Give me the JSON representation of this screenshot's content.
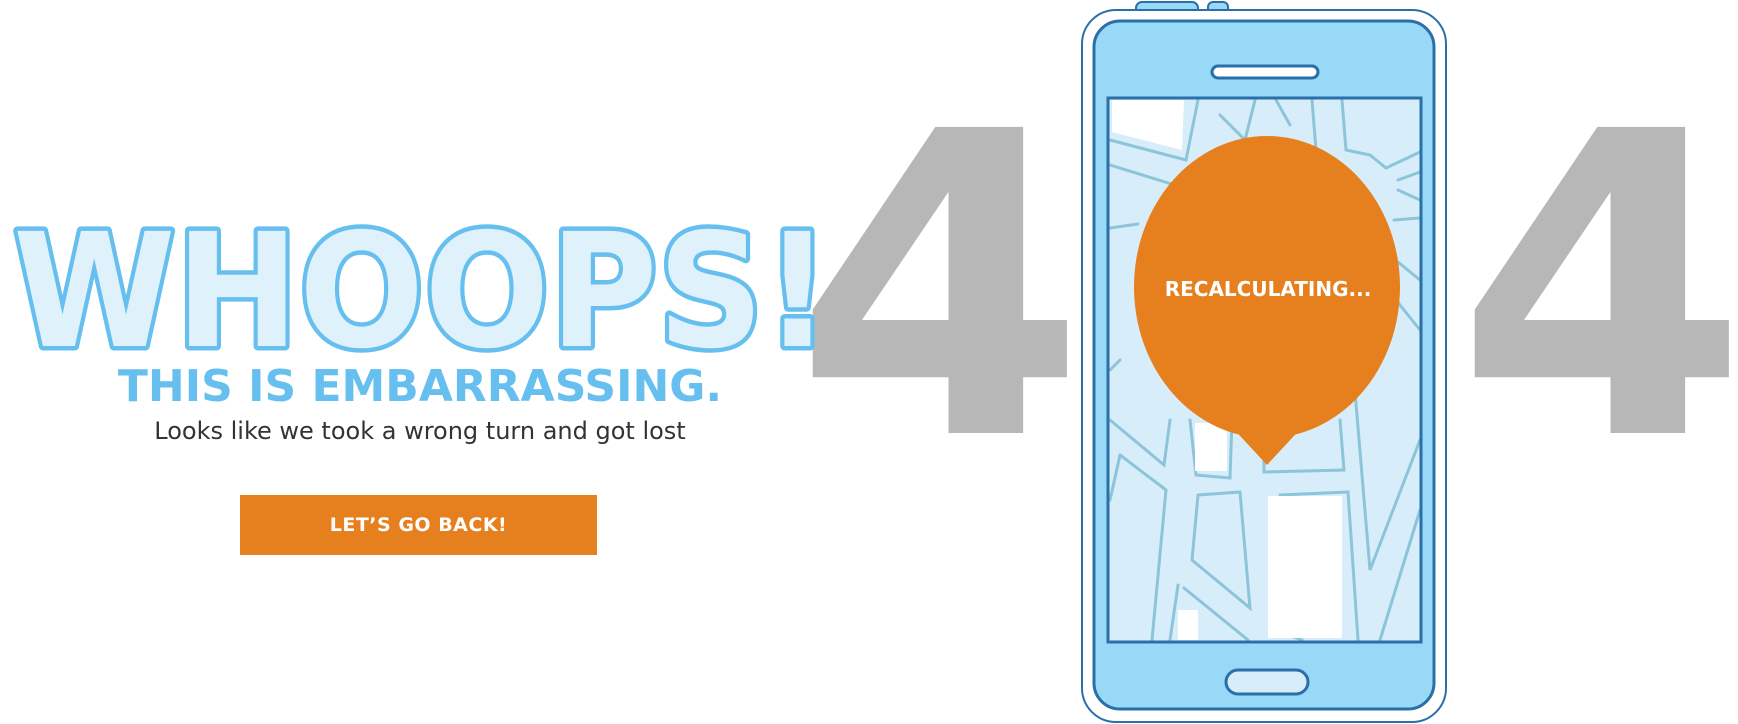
{
  "hero": {
    "headline": "WHOOPS!",
    "subheadline": "THIS IS EMBARRASSING.",
    "tagline": "Looks like we took a wrong turn and got lost"
  },
  "actions": {
    "back_label": "LET’S GO BACK!"
  },
  "error": {
    "digit_left": "4",
    "digit_right": "4"
  },
  "phone": {
    "bubble_text": "RECALCULATING..."
  },
  "colors": {
    "accent_orange": "#e6801e",
    "headline_blue": "#66bfee",
    "headline_fill": "#dff2fc",
    "digit_gray": "#b7b7b7",
    "phone_body": "#97d9f6",
    "phone_outline": "#2a6fa8",
    "map_bg": "#d7eefa",
    "map_roads": "#8cc4da"
  },
  "icons": {
    "phone": "smartphone-icon",
    "bubble": "map-pin-icon"
  }
}
